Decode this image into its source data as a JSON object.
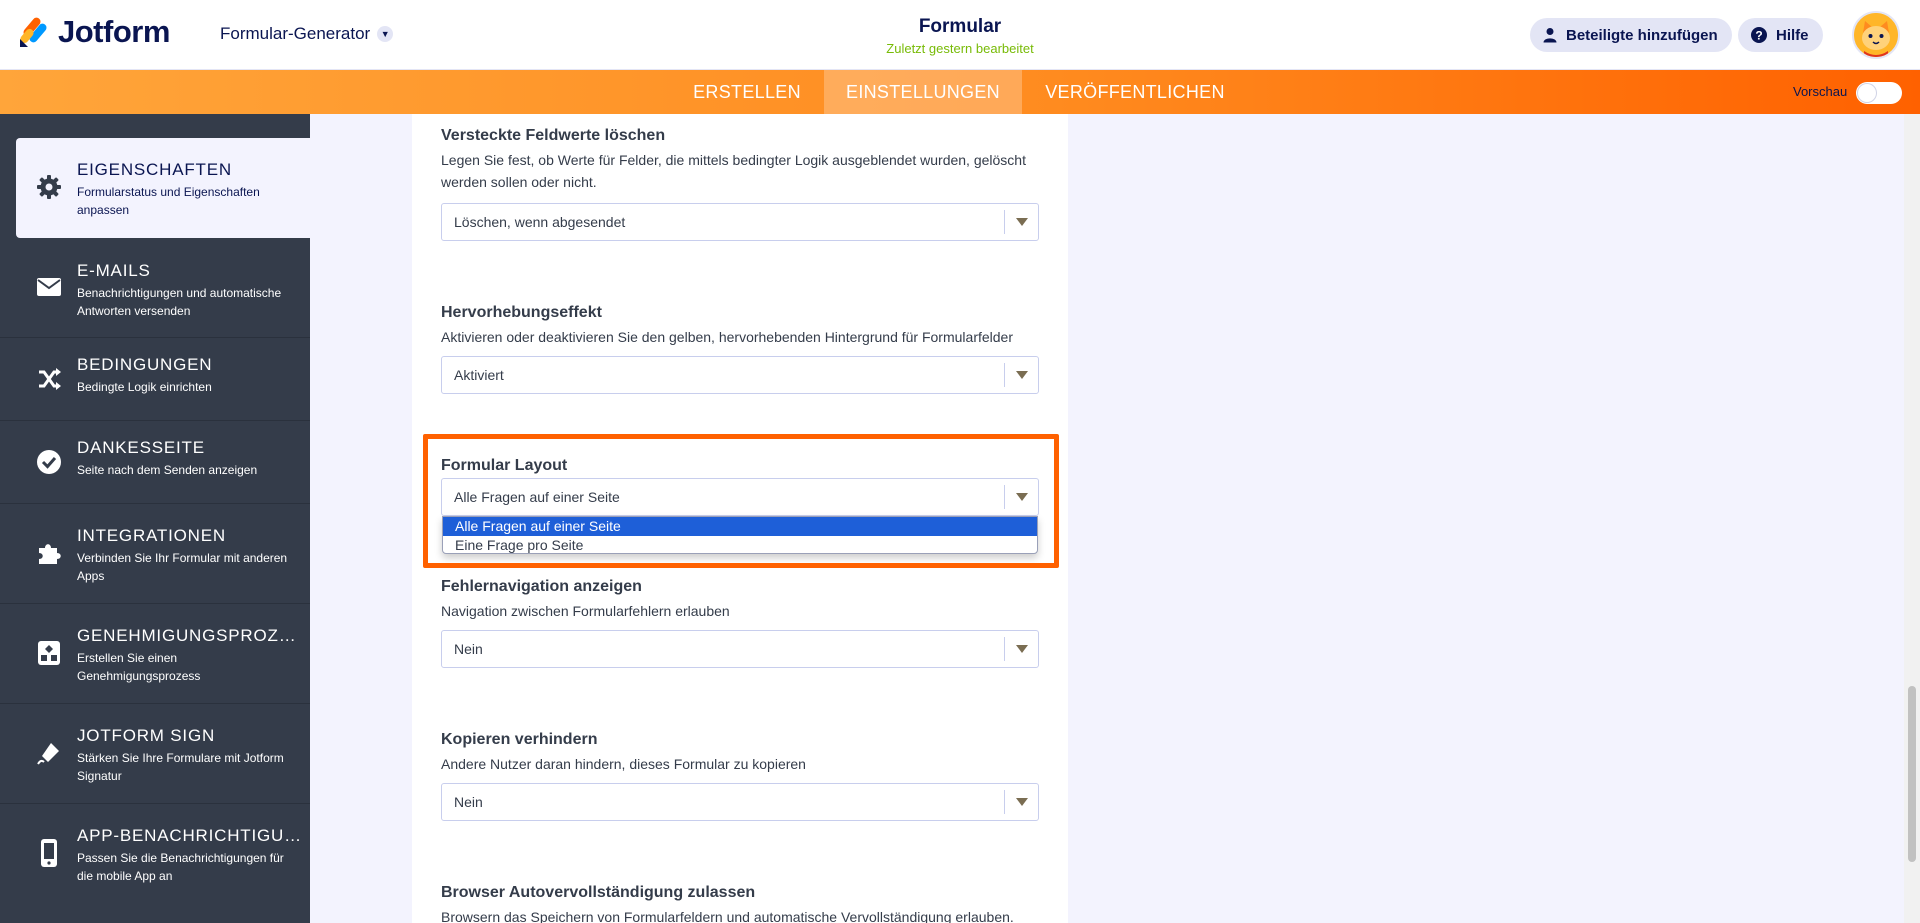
{
  "header": {
    "logo_text": "Jotform",
    "builder_menu": "Formular-Generator",
    "form_title": "Formular",
    "form_subtitle": "Zuletzt gestern bearbeitet",
    "add_collaborators": "Beteiligte hinzufügen",
    "help": "Hilfe"
  },
  "nav": {
    "tabs": [
      "ERSTELLEN",
      "EINSTELLUNGEN",
      "VERÖFFENTLICHEN"
    ],
    "active_tab": "EINSTELLUNGEN",
    "preview_label": "Vorschau",
    "preview_on": false
  },
  "sidebar": {
    "items": [
      {
        "title": "EIGENSCHAFTEN",
        "desc": "Formularstatus und Eigenschaften anpassen",
        "icon": "gear-icon",
        "active": true
      },
      {
        "title": "E-MAILS",
        "desc": "Benachrichtigungen und automatische Antworten versenden",
        "icon": "envelope-icon",
        "active": false
      },
      {
        "title": "BEDINGUNGEN",
        "desc": "Bedingte Logik einrichten",
        "icon": "shuffle-icon",
        "active": false
      },
      {
        "title": "DANKESSEITE",
        "desc": "Seite nach dem Senden anzeigen",
        "icon": "check-circle-icon",
        "active": false
      },
      {
        "title": "INTEGRATIONEN",
        "desc": "Verbinden Sie Ihr Formular mit anderen Apps",
        "icon": "puzzle-icon",
        "active": false
      },
      {
        "title": "GENEHMIGUNGSPROZE...",
        "desc": "Erstellen Sie einen Genehmigungsprozess",
        "icon": "workflow-icon",
        "active": false
      },
      {
        "title": "JOTFORM SIGN",
        "desc": "Stärken Sie Ihre Formulare mit Jotform Signatur",
        "icon": "signature-pen-icon",
        "active": false
      },
      {
        "title": "APP-BENACHRICHTIGUNG",
        "desc": "Passen Sie die Benachrichtigungen für die mobile App an",
        "icon": "mobile-icon",
        "active": false
      }
    ]
  },
  "settings": {
    "hidden_values": {
      "label": "Versteckte Feldwerte löschen",
      "desc": "Legen Sie fest, ob Werte für Felder, die mittels bedingter Logik ausgeblendet wurden, gelöscht werden sollen oder nicht.",
      "value": "Löschen, wenn abgesendet"
    },
    "highlight": {
      "label": "Hervorhebungseffekt",
      "desc": "Aktivieren oder deaktivieren Sie den gelben, hervorhebenden Hintergrund für Formularfelder",
      "value": "Aktiviert"
    },
    "layout": {
      "label": "Formular Layout",
      "value": "Alle Fragen auf einer Seite",
      "options": [
        "Alle Fragen auf einer Seite",
        "Eine Frage pro Seite"
      ],
      "selected_index": 0
    },
    "error_nav": {
      "label": "Fehlernavigation anzeigen",
      "desc": "Navigation zwischen Formularfehlern erlauben",
      "value": "Nein"
    },
    "prevent_copy": {
      "label": "Kopieren verhindern",
      "desc": "Andere Nutzer daran hindern, dieses Formular zu kopieren",
      "value": "Nein"
    },
    "autocomplete": {
      "label": "Browser Autovervollständigung zulassen",
      "desc": "Browsern das Speichern von Formularfeldern und automatische Vervollständigung erlauben."
    }
  },
  "colors": {
    "accent_orange": "#ff6100",
    "sidebar_bg": "#343c4a",
    "subtitle_green": "#78bb07",
    "selected_option": "#1e5fd8"
  }
}
